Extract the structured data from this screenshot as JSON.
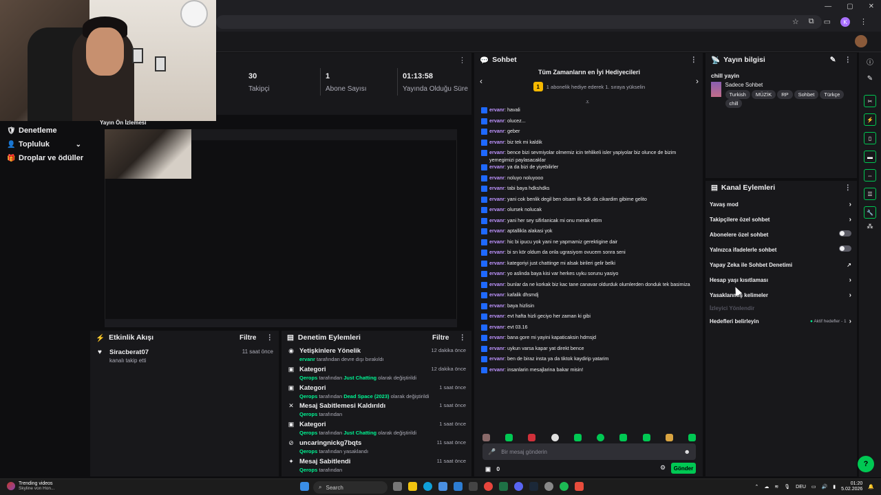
{
  "left_nav": [
    {
      "label": "Denetleme",
      "icon": "shield-icon"
    },
    {
      "label": "Topluluk",
      "icon": "user-icon"
    },
    {
      "label": "Droplar ve ödüller",
      "icon": "gift-icon"
    }
  ],
  "stats": [
    {
      "value": "30",
      "label": "Takipçi"
    },
    {
      "value": "1",
      "label": "Abone Sayısı"
    },
    {
      "value": "01:13:58",
      "label": "Yayında Olduğu Süre"
    }
  ],
  "preview": {
    "title": "Yayın Ön İzlemesi"
  },
  "activity": {
    "title": "Etkinlik Akışı",
    "filter": "Filtre",
    "items": [
      {
        "name": "Siracberat07",
        "desc": "kanalı takip etti",
        "time": "11 saat önce"
      }
    ]
  },
  "moderation": {
    "title": "Denetim Eylemleri",
    "filter": "Filtre",
    "items": [
      {
        "title": "Yetişkinlere Yönelik",
        "actor": "ervanr",
        "mid": " tarafından devre dışı bırakıldı",
        "hl": "",
        "tail": "",
        "time": "12 dakika önce"
      },
      {
        "title": "Kategori",
        "actor": "Qerops",
        "mid": " tarafından ",
        "hl": "Just Chatting",
        "tail": " olarak değiştirildi",
        "time": "12 dakika önce"
      },
      {
        "title": "Kategori",
        "actor": "Qerops",
        "mid": " tarafından ",
        "hl": "Dead Space (2023)",
        "tail": " olarak değiştirildi",
        "time": "1 saat önce"
      },
      {
        "title": "Mesaj Sabitlemesi Kaldırıldı",
        "actor": "Qerops",
        "mid": " tarafından",
        "hl": "",
        "tail": "",
        "time": "1 saat önce"
      },
      {
        "title": "Kategori",
        "actor": "Qerops",
        "mid": " tarafından ",
        "hl": "Just Chatting",
        "tail": " olarak değiştirildi",
        "time": "1 saat önce"
      },
      {
        "title": "uncaringnickg7bqts",
        "actor": "Qerops",
        "mid": " tarafından yasaklandı",
        "hl": "",
        "tail": "",
        "time": "11 saat önce"
      },
      {
        "title": "Mesaj Sabitlendi",
        "actor": "Qerops",
        "mid": " tarafından",
        "hl": "",
        "tail": "",
        "time": "11 saat önce"
      }
    ]
  },
  "chat": {
    "title": "Sohbet",
    "leader_title": "Tüm Zamanların en İyi Hediyecileri",
    "leader_badge": "1",
    "leader_sub": "1 abonelik hediye ederek 1. sıraya yükselin",
    "input_placeholder": "Bir mesaj gönderin",
    "send_label": "Gönder",
    "points": "0",
    "messages": [
      {
        "user": "ervanr",
        "text": ": havali"
      },
      {
        "user": "ervanr",
        "text": ": olucez..."
      },
      {
        "user": "ervanr",
        "text": ": geber"
      },
      {
        "user": "ervanr",
        "text": ": biz tek mi kaldik"
      },
      {
        "user": "ervanr",
        "text": ": bence bizi sevmiyolar olmemiz icin tehlikeli isler yapiyolar biz olunce de bizim yemegimizi paylasacaklar"
      },
      {
        "user": "ervanr",
        "text": ": ya da bizi de yiyebilirler"
      },
      {
        "user": "ervanr",
        "text": ": noluyo noluyooo"
      },
      {
        "user": "ervanr",
        "text": ": tabi baya hdkshdks"
      },
      {
        "user": "ervanr",
        "text": ": yani cok benlik degil ben olsam ilk 5dk da cikardim gibime gelito"
      },
      {
        "user": "ervanr",
        "text": ": olursek nolucak"
      },
      {
        "user": "ervanr",
        "text": ": yani her sey sifirlanicak mi onu merak ettim"
      },
      {
        "user": "ervanr",
        "text": ": aptallikla alakasi yok"
      },
      {
        "user": "ervanr",
        "text": ": hic bi ipucu yok yani ne yapmamiz gerektigine dair"
      },
      {
        "user": "ervanr",
        "text": ": bi sn kör oldum da onla ugrasiyom ovucem sonra seni"
      },
      {
        "user": "ervanr",
        "text": ": kategoriyi just chattinge mi alsak birileri gelir belki"
      },
      {
        "user": "ervanr",
        "text": ": yo aslinda baya kisi var herkes uyku sorunu yasiyo"
      },
      {
        "user": "ervanr",
        "text": ": bunlar da ne korkak biz kac tane canavar oldurduk olumlerden donduk tek basimiza"
      },
      {
        "user": "ervanr",
        "text": ": kafalik dhsmdj"
      },
      {
        "user": "ervanr",
        "text": ": baya hizlisin"
      },
      {
        "user": "ervanr",
        "text": ": evt hafta hizli geciyo her zaman ki gibi"
      },
      {
        "user": "ervanr",
        "text": ": evt 03.16"
      },
      {
        "user": "ervanr",
        "text": ": bana gore mi yayini kapaticaksin hdmsjd"
      },
      {
        "user": "ervanr",
        "text": ": uykun varsa kapar yat direkt bence"
      },
      {
        "user": "ervanr",
        "text": ": ben de biraz insta ya da tiktok kaydirip yatarim"
      },
      {
        "user": "ervanr",
        "text": ": insanlarin mesajlarina bakar misin!"
      }
    ]
  },
  "stream_info": {
    "title": "Yayın bilgisi",
    "stream_title": "chill yayin",
    "category": "Sadece Sohbet",
    "tags": [
      "Turkish",
      "MÜZİK",
      "RP",
      "Sohbet",
      "Türkçe",
      "chill"
    ]
  },
  "channel_actions": {
    "title": "Kanal Eylemleri",
    "rows": [
      {
        "label": "Yavaş mod",
        "kind": "chevron"
      },
      {
        "label": "Takipçilere özel sohbet",
        "kind": "chevron"
      },
      {
        "label": "Abonelere özel sohbet",
        "kind": "toggle"
      },
      {
        "label": "Yalnızca ifadelerle sohbet",
        "kind": "toggle"
      },
      {
        "label": "Yapay Zeka ile Sohbet Denetimi",
        "kind": "external"
      },
      {
        "label": "Hesap yaşı kısıtlaması",
        "kind": "chevron"
      },
      {
        "label": "Yasaklanmış kelimeler",
        "kind": "chevron"
      }
    ],
    "disabled_label": "İzleyici Yönlendir",
    "goals_label": "Hedefleri belirleyin",
    "goals_status": "Aktif hedefler - 1"
  },
  "taskbar": {
    "widget_title": "Trending videos",
    "widget_sub": "Skyline von Hon...",
    "search": "Search",
    "lang": "DEU",
    "time": "01:20",
    "date": "5.02.2026"
  }
}
